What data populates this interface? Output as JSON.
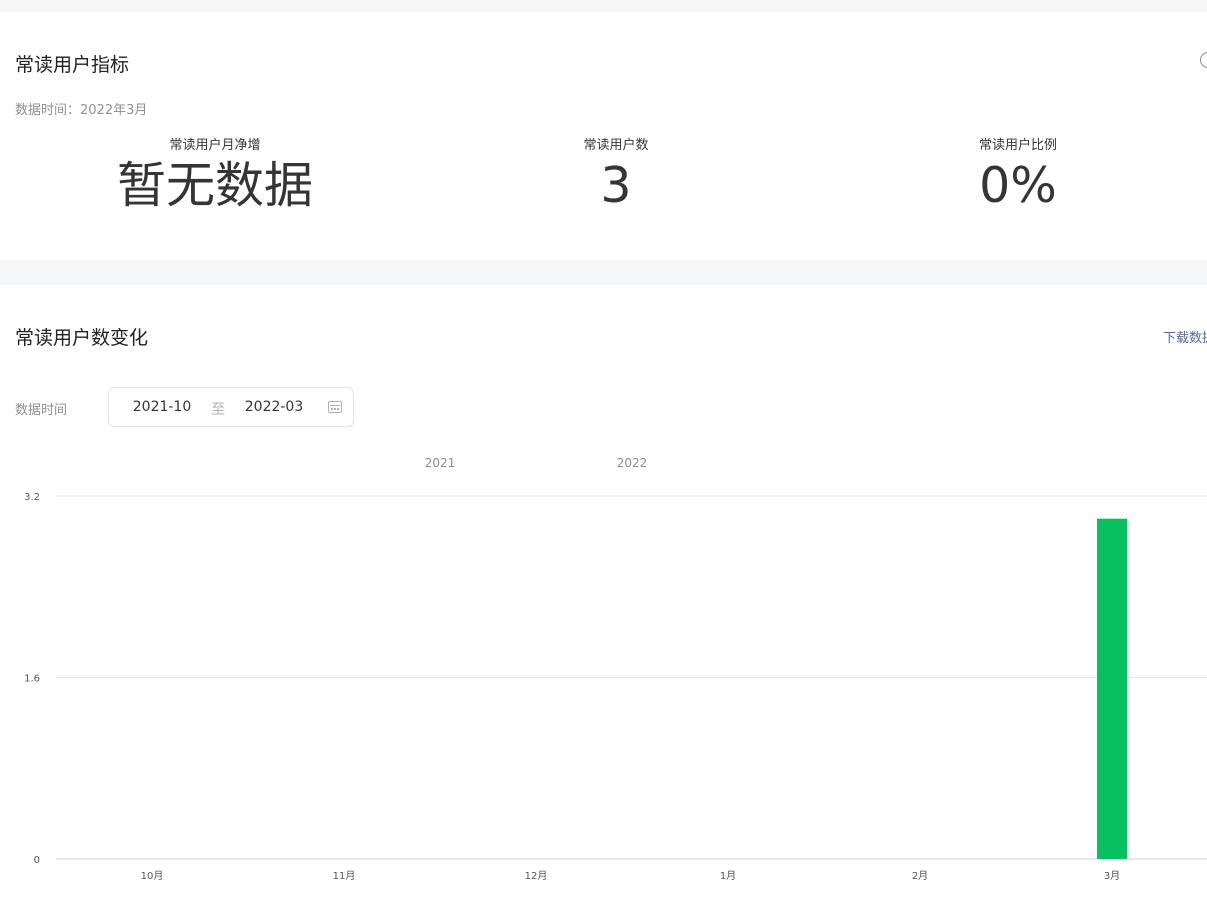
{
  "overview": {
    "title": "常读用户指标",
    "data_time": "数据时间：2022年3月",
    "metrics": [
      {
        "label": "常读用户月净增",
        "value": "暂无数据"
      },
      {
        "label": "常读用户数",
        "value": "3"
      },
      {
        "label": "常读用户比例",
        "value": "0%"
      }
    ]
  },
  "trend": {
    "title": "常读用户数变化",
    "download_label": "下载数据",
    "filter_label": "数据时间",
    "date_start": "2021-10",
    "date_separator": "至",
    "date_end": "2022-03"
  },
  "icons": {
    "help": "help-circle-icon",
    "calendar": "calendar-icon"
  },
  "colors": {
    "bar": "#07c160",
    "link": "#576b95",
    "grid": "#e7e7e7"
  },
  "chart_data": {
    "type": "bar",
    "categories": [
      "10月",
      "11月",
      "12月",
      "1月",
      "2月",
      "3月"
    ],
    "year_labels": [
      {
        "label": "2021",
        "at_category": 2
      },
      {
        "label": "2022",
        "at_category": 3
      }
    ],
    "values": [
      0,
      0,
      0,
      0,
      0,
      3
    ],
    "yticks": [
      0,
      1.6,
      3.2
    ],
    "ylim": [
      0,
      3.2
    ],
    "grid": true,
    "title": "",
    "xlabel": "",
    "ylabel": ""
  }
}
